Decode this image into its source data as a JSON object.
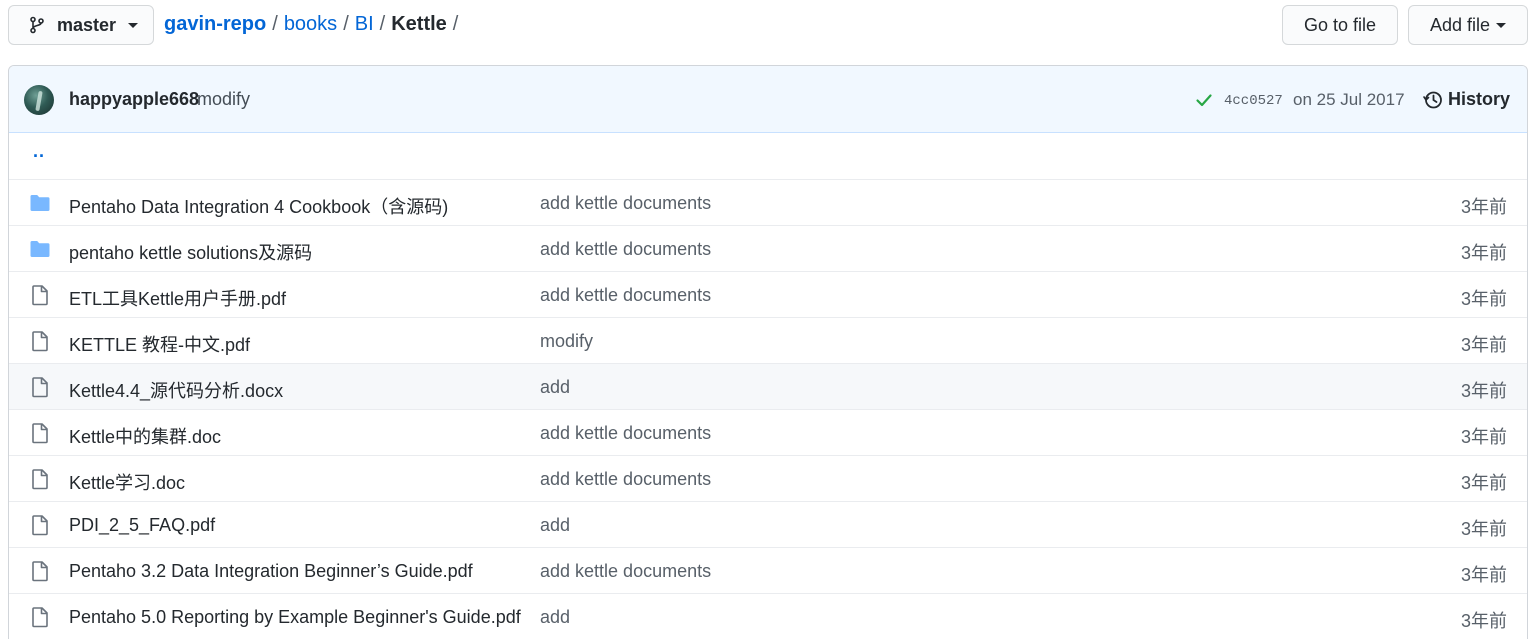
{
  "branch": {
    "name": "master",
    "icon": "git-branch-icon"
  },
  "breadcrumb": {
    "repo": "gavin-repo",
    "segments": [
      "books",
      "BI"
    ],
    "current": "Kettle",
    "separator": "/"
  },
  "actions": {
    "go_to_file": "Go to file",
    "add_file": "Add file"
  },
  "commit": {
    "author": "happyapple668",
    "message": "modify",
    "status": "success",
    "sha": "4cc0527",
    "date": "on 25 Jul 2017",
    "history_label": "History"
  },
  "colors": {
    "link": "#0366d6",
    "folder": "#79b8ff",
    "success": "#28a745",
    "commit_bg": "#f1f8ff"
  },
  "files": {
    "updir": "..",
    "rows": [
      {
        "type": "folder",
        "name": "Pentaho Data Integration 4 Cookbook（含源码)",
        "message": "add kettle documents",
        "age": "3年前"
      },
      {
        "type": "folder",
        "name": "pentaho kettle solutions及源码",
        "message": "add kettle documents",
        "age": "3年前"
      },
      {
        "type": "file",
        "name": "ETL工具Kettle用户手册.pdf",
        "message": "add kettle documents",
        "age": "3年前"
      },
      {
        "type": "file",
        "name": "KETTLE 教程-中文.pdf",
        "message": "modify",
        "age": "3年前"
      },
      {
        "type": "file",
        "name": "Kettle4.4_源代码分析.docx",
        "message": "add",
        "age": "3年前"
      },
      {
        "type": "file",
        "name": "Kettle中的集群.doc",
        "message": "add kettle documents",
        "age": "3年前"
      },
      {
        "type": "file",
        "name": "Kettle学习.doc",
        "message": "add kettle documents",
        "age": "3年前"
      },
      {
        "type": "file",
        "name": "PDI_2_5_FAQ.pdf",
        "message": "add",
        "age": "3年前"
      },
      {
        "type": "file",
        "name": "Pentaho 3.2 Data Integration Beginner’s Guide.pdf",
        "message": "add kettle documents",
        "age": "3年前"
      },
      {
        "type": "file",
        "name": "Pentaho 5.0 Reporting by Example Beginner's Guide.pdf",
        "message": "add",
        "age": "3年前"
      }
    ]
  }
}
